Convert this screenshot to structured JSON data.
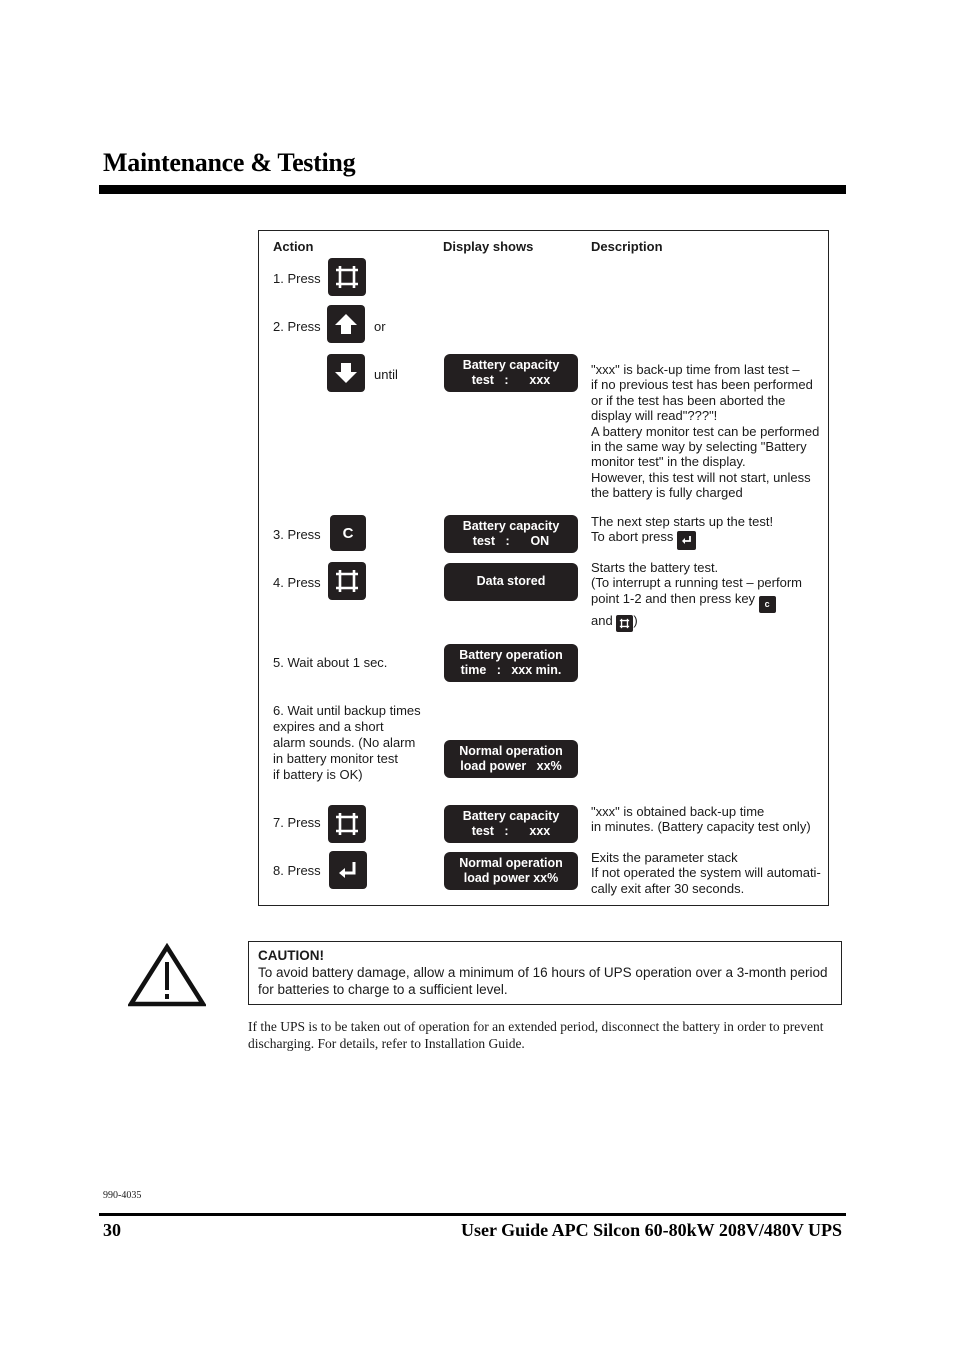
{
  "header": {
    "title": "Maintenance & Testing"
  },
  "table": {
    "columns": [
      "Action",
      "Display shows",
      "Description"
    ],
    "steps": [
      {
        "action": "1. Press",
        "key": "menu-key",
        "suffix": "",
        "display": null,
        "description": ""
      },
      {
        "action": "2. Press",
        "key": "up-arrow-key",
        "suffix": "or",
        "display": null,
        "description": ""
      },
      {
        "action": "",
        "key": "down-arrow-key",
        "suffix": "until",
        "display": [
          "Battery capacity",
          "test   :      xxx"
        ],
        "description": "\"xxx\" is back-up time from last test –\nif no previous test has been performed\nor if the test has been aborted the\ndisplay will read\"???\"!\nA battery monitor test can be performed\nin the same way by selecting \"Battery\nmonitor test\" in the display.\nHowever, this test will not start, unless\nthe battery is fully charged"
      },
      {
        "action": "3. Press",
        "key": "c-key",
        "key_label": "C",
        "suffix": "",
        "display": [
          "Battery capacity",
          "test   :      ON"
        ],
        "description_lines": [
          "The next step starts up the test!",
          "To abort press"
        ]
      },
      {
        "action": "4. Press",
        "key": "menu-key",
        "suffix": "",
        "display": [
          "Data stored"
        ],
        "description_lines": [
          "Starts the battery test.",
          "(To interrupt a running test – perform",
          "point 1-2 and then press key",
          "and",
          ")"
        ]
      },
      {
        "action": "5. Wait about 1 sec.",
        "display": [
          "Battery operation",
          "time   :   xxx min."
        ],
        "description": ""
      },
      {
        "action": "6.  Wait until backup times\n     expires and a short\n     alarm sounds. (No alarm\n     in battery monitor test\n     if battery is OK)",
        "display": [
          "Normal operation",
          "load power   xx%"
        ],
        "description": ""
      },
      {
        "action": "7.  Press",
        "key": "menu-key",
        "suffix": "",
        "display": [
          "Battery capacity",
          "test   :      xxx"
        ],
        "description": "\"xxx\" is obtained back-up time\nin minutes. (Battery capacity test only)"
      },
      {
        "action": "8.  Press",
        "key": "enter-key",
        "suffix": "",
        "display": [
          "Normal operation",
          "load power xx%"
        ],
        "description": "Exits the parameter stack\nIf not operated the system will automati-\ncally exit after 30 seconds."
      }
    ]
  },
  "caution": {
    "heading": "CAUTION!",
    "text": "To avoid battery damage, allow  a minimum of 16 hours of UPS operation over a 3-month period for batteries to charge to a sufficient level."
  },
  "body_paragraph": "If the UPS is to be taken out of operation for an extended period, disconnect the battery in order to prevent discharging. For details, refer to Installation Guide.",
  "footer": {
    "doc_number": "990-4035",
    "page_number": "30",
    "guide_title": "User Guide APC Silcon 60-80kW 208V/480V UPS"
  }
}
